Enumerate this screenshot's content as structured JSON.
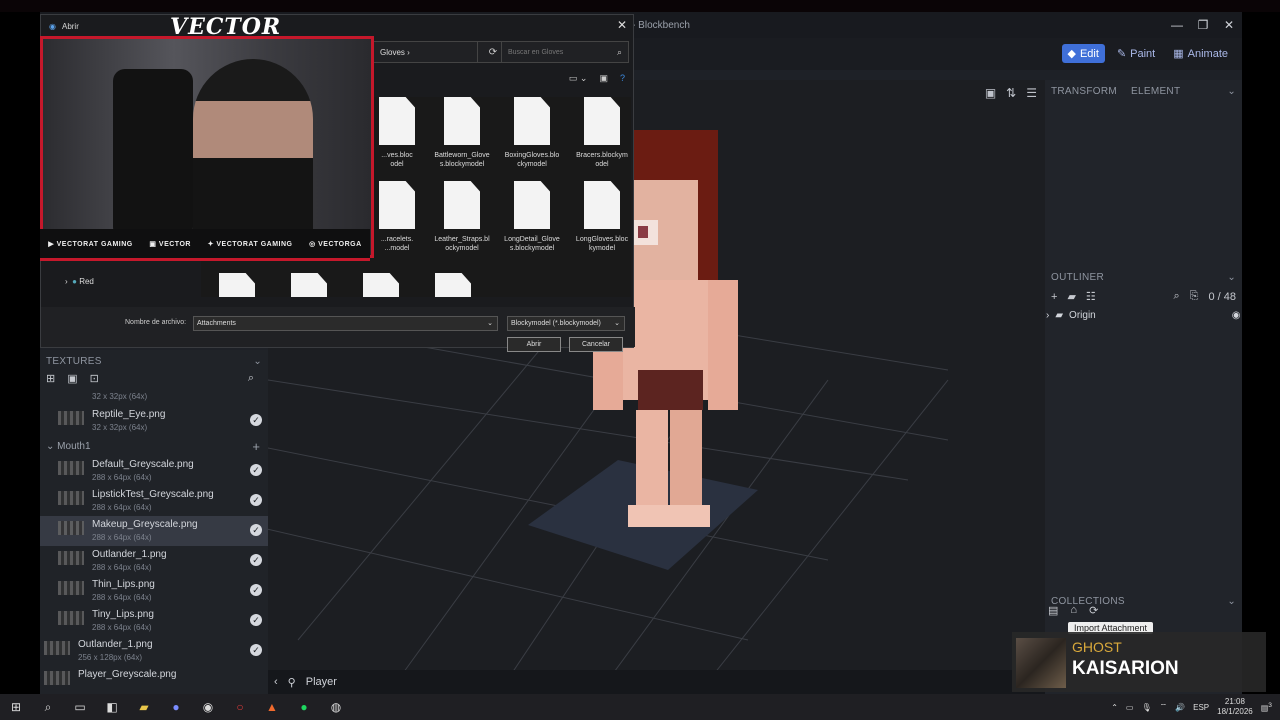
{
  "app": {
    "title": "● Player - Blockbench"
  },
  "modes": [
    {
      "label": "Edit"
    },
    {
      "label": "Paint"
    },
    {
      "label": "Animate"
    }
  ],
  "right_panel": {
    "transform_tab": "TRANSFORM",
    "element_tab": "ELEMENT",
    "outliner_title": "OUTLINER",
    "outliner_count": "0 / 48",
    "outliner_item": "Origin",
    "collections_title": "COLLECTIONS",
    "tooltip": "Import Attachment"
  },
  "textures": {
    "title": "TEXTURES",
    "group": "Mouth1",
    "top_size": "32 x 32px (64x)",
    "items": [
      {
        "name": "Reptile_Eye.png",
        "size": "32 x 32px (64x)"
      },
      {
        "name": "Default_Greyscale.png",
        "size": "288 x 64px (64x)"
      },
      {
        "name": "LipstickTest_Greyscale.png",
        "size": "288 x 64px (64x)"
      },
      {
        "name": "Makeup_Greyscale.png",
        "size": "288 x 64px (64x)"
      },
      {
        "name": "Outlander_1.png",
        "size": "288 x 64px (64x)"
      },
      {
        "name": "Thin_Lips.png",
        "size": "288 x 64px (64x)"
      },
      {
        "name": "Tiny_Lips.png",
        "size": "288 x 64px (64x)"
      },
      {
        "name": "Outlander_1.png",
        "size": "256 x 128px (64x)"
      },
      {
        "name": "Player_Greyscale.png",
        "size": ""
      }
    ]
  },
  "viewport": {
    "tab": "Player",
    "zoom": "30"
  },
  "dialog": {
    "title": "Abrir",
    "folder": "Gloves",
    "search_placeholder": "Buscar en Gloves",
    "tree_item": "Red",
    "files": [
      {
        "name": "...ves.bloc\nodel"
      },
      {
        "name": "Battleworn_Glove\ns.blockymodel"
      },
      {
        "name": "BoxingGloves.blo\nckymodel"
      },
      {
        "name": "Bracers.blockym\nodel"
      },
      {
        "name": "...racelets.\n...model"
      },
      {
        "name": "Leather_Straps.bl\nockymodel"
      },
      {
        "name": "LongDetail_Glove\ns.blockymodel"
      },
      {
        "name": "LongGloves.bloc\nkymodel"
      }
    ],
    "filename_label": "Nombre de archivo:",
    "filename_value": "Attachments",
    "filetype": "Blockymodel (*.blockymodel)",
    "open_btn": "Abrir",
    "cancel_btn": "Cancelar"
  },
  "stream": {
    "logo": "VECTOR",
    "socials": [
      "VECTORAT GAMING",
      "VECTOR",
      "VECTORAT GAMING",
      "VECTORGA"
    ]
  },
  "nowplaying": {
    "artist": "GHOST",
    "track": "KAISARION"
  },
  "taskbar": {
    "lang": "ESP",
    "time": "21:08",
    "date": "18/1/2026",
    "notif": "3"
  }
}
